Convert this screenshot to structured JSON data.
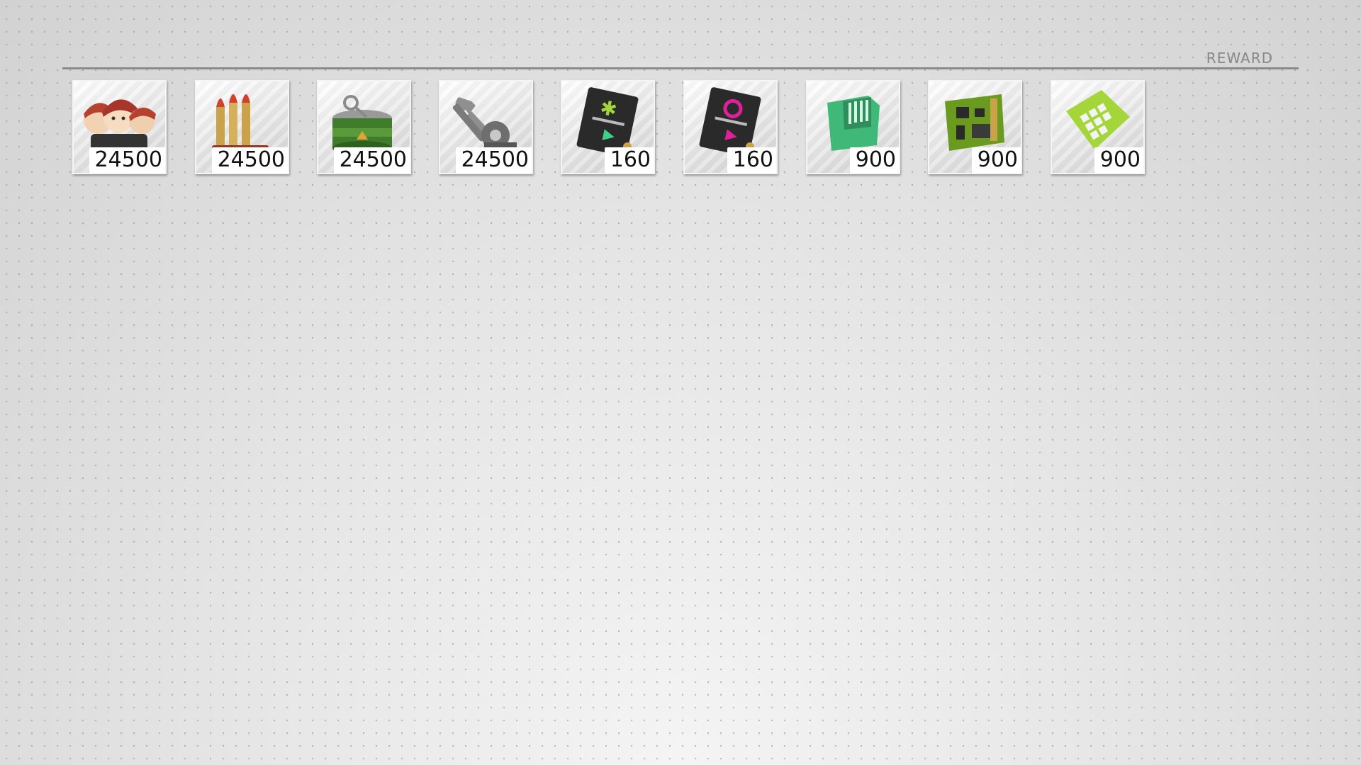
{
  "header": {
    "title": "REWARD"
  },
  "rewards": [
    {
      "icon": "manpower-icon",
      "count": "24500"
    },
    {
      "icon": "ammo-icon",
      "count": "24500"
    },
    {
      "icon": "rations-icon",
      "count": "24500"
    },
    {
      "icon": "parts-icon",
      "count": "24500"
    },
    {
      "icon": "quick-production-contract-icon",
      "count": "160"
    },
    {
      "icon": "quick-repair-contract-icon",
      "count": "160"
    },
    {
      "icon": "combat-sim-data-icon",
      "count": "900"
    },
    {
      "icon": "circuit-board-icon",
      "count": "900"
    },
    {
      "icon": "data-patch-icon",
      "count": "900"
    }
  ],
  "colors": {
    "accent_green": "#3fcf86",
    "accent_lime": "#a4d63a",
    "accent_magenta": "#e0209a",
    "brass": "#c9a24a"
  }
}
